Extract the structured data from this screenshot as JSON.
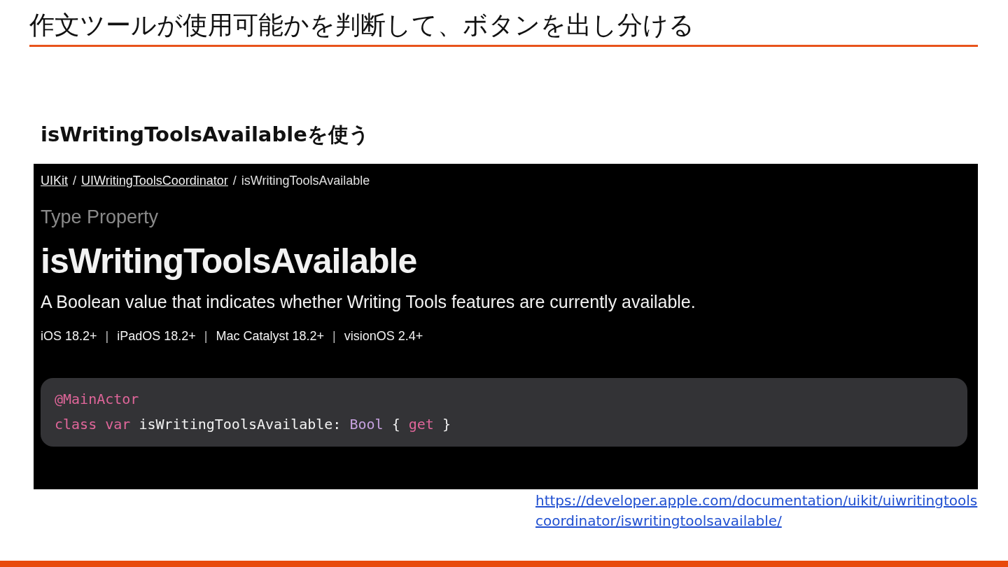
{
  "slide_title": "作文ツールが使用可能かを判断して、ボタンを出し分ける",
  "subtitle": "isWritingToolsAvailableを使う",
  "doc": {
    "breadcrumb": [
      {
        "text": "UIKit",
        "kind": "link"
      },
      {
        "text": "/",
        "kind": "separator"
      },
      {
        "text": "UIWritingToolsCoordinator",
        "kind": "link"
      },
      {
        "text": "/",
        "kind": "separator"
      },
      {
        "text": "isWritingToolsAvailable",
        "kind": "current"
      }
    ],
    "eyebrow": "Type Property",
    "title": "isWritingToolsAvailable",
    "abstract": "A Boolean value that indicates whether Writing Tools features are currently available.",
    "platforms": [
      {
        "text": "iOS 18.2+",
        "kind": "platform"
      },
      {
        "text": "|",
        "kind": "separator"
      },
      {
        "text": "iPadOS 18.2+",
        "kind": "platform"
      },
      {
        "text": "|",
        "kind": "separator"
      },
      {
        "text": "Mac Catalyst 18.2+",
        "kind": "platform"
      },
      {
        "text": "|",
        "kind": "separator"
      },
      {
        "text": "visionOS 2.4+",
        "kind": "platform"
      }
    ],
    "code": [
      [
        {
          "text": "@MainActor",
          "kind": "keyword"
        }
      ],
      [
        {
          "text": "class ",
          "kind": "keyword"
        },
        {
          "text": "var",
          "kind": "keyword"
        },
        {
          "text": " isWritingToolsAvailable: ",
          "kind": "plain"
        },
        {
          "text": "Bool",
          "kind": "type"
        },
        {
          "text": " { ",
          "kind": "plain"
        },
        {
          "text": "get",
          "kind": "keyword"
        },
        {
          "text": " }",
          "kind": "plain"
        }
      ]
    ]
  },
  "source_link": "https://developer.apple.com/documentation/uikit/uiwritingtoolscoordinator/iswritingtoolsavailable/"
}
